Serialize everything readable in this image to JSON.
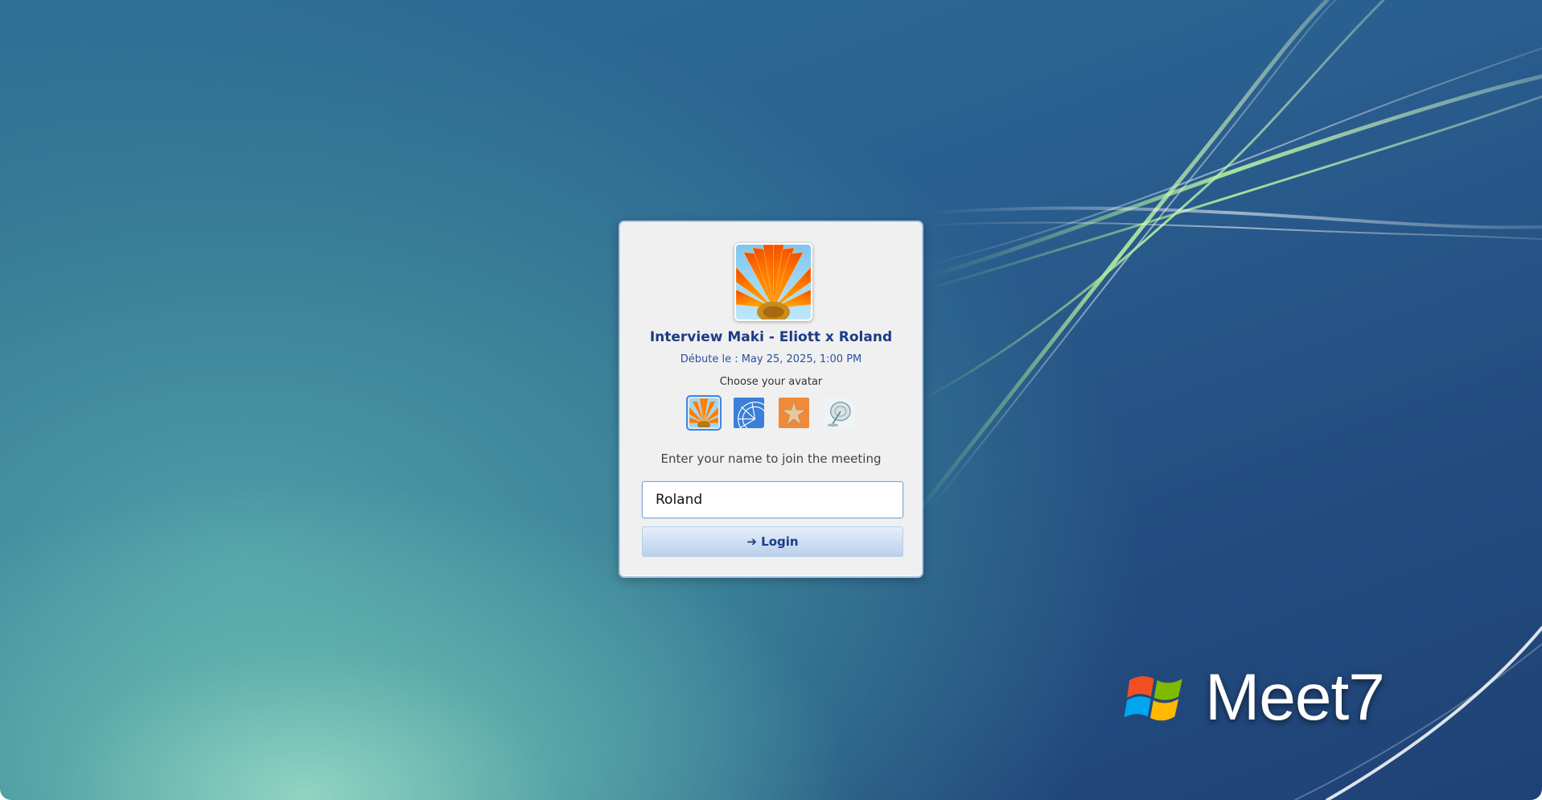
{
  "meeting": {
    "title": "Interview Maki - Eliott x Roland",
    "start": "Débute le : May 25, 2025, 1:00 PM"
  },
  "avatar_picker": {
    "label": "Choose your avatar",
    "options": [
      "flower",
      "ferris-wheel",
      "starfish",
      "satellite-dish"
    ],
    "selected": "flower"
  },
  "join": {
    "prompt": "Enter your name to join the meeting",
    "name_value": "Roland",
    "login_label": "➔ Login"
  },
  "brand": {
    "name": "Meet7"
  },
  "colors": {
    "title": "#1c3a86",
    "accent": "#3d86e0",
    "card_bg": "#f0f0f0"
  }
}
